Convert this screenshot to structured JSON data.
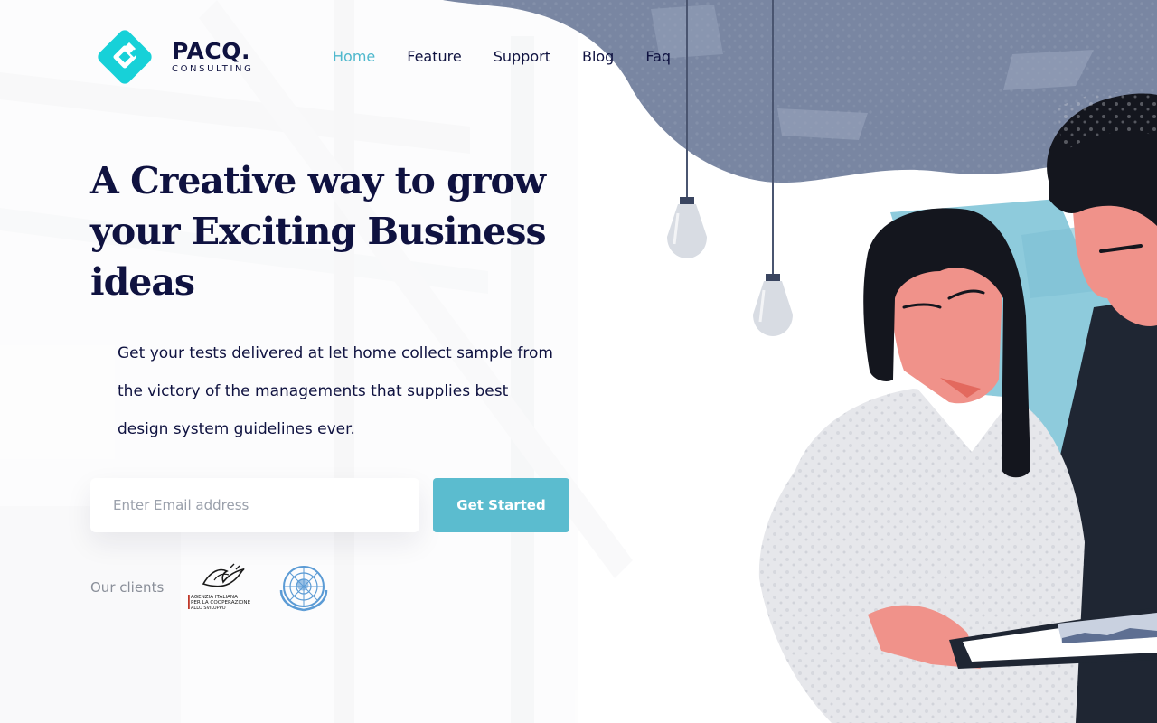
{
  "brand": {
    "name": "PACQ.",
    "tagline": "CONSULTING",
    "color": "#17d1d8"
  },
  "nav": {
    "items": [
      {
        "label": "Home",
        "active": true
      },
      {
        "label": "Feature",
        "active": false
      },
      {
        "label": "Support",
        "active": false
      },
      {
        "label": "Blog",
        "active": false
      },
      {
        "label": "Faq",
        "active": false
      }
    ],
    "active_color": "#4fb8cd"
  },
  "hero": {
    "title_line1": "A Creative way to grow",
    "title_line2": "your Exciting Business",
    "title_line3": "ideas",
    "desc_line1": "Get your tests delivered at let home collect sample from",
    "desc_line2": "the victory of the managements that supplies best",
    "desc_line3": "design system guidelines ever."
  },
  "signup": {
    "email_placeholder": "Enter Email address",
    "email_value": "",
    "button_label": "Get Started",
    "button_color": "#5bbccf"
  },
  "clients": {
    "label": "Our clients",
    "logos": [
      {
        "name": "agenzia-italiana-icon",
        "lines": [
          "AGENZIA ITALIANA",
          "PER LA COOPERAZIONE",
          "ALLO SVILUPPO"
        ]
      },
      {
        "name": "united-nations-icon"
      }
    ]
  },
  "colors": {
    "heading": "#0f1240",
    "accent": "#5bbccf",
    "muted": "#8a8f99"
  }
}
